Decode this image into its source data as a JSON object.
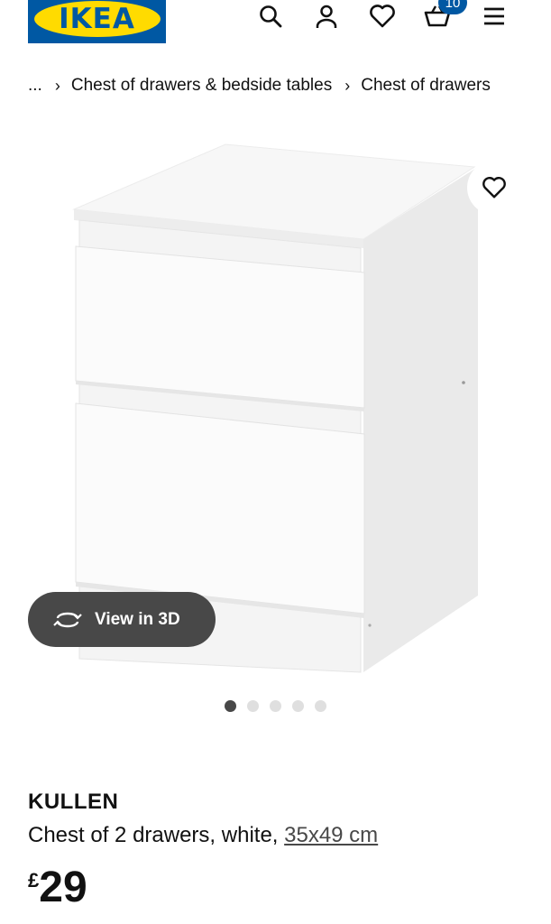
{
  "header": {
    "logo_text": "IKEA",
    "icons": [
      "search-icon",
      "user-icon",
      "heart-icon",
      "basket-icon",
      "menu-icon"
    ],
    "basket_count": "10",
    "brand_blue": "#0058a3",
    "brand_yellow": "#ffdb00"
  },
  "breadcrumb": {
    "ellipsis": "...",
    "items": [
      "Chest of drawers & bedside tables",
      "Chest of drawers"
    ]
  },
  "gallery": {
    "view3d_label": "View in 3D",
    "dot_count": 5,
    "active_dot": 1
  },
  "product": {
    "name": "KULLEN",
    "description": "Chest of 2 drawers, white,",
    "size": "35x49 cm",
    "currency": "£",
    "price": "29"
  }
}
